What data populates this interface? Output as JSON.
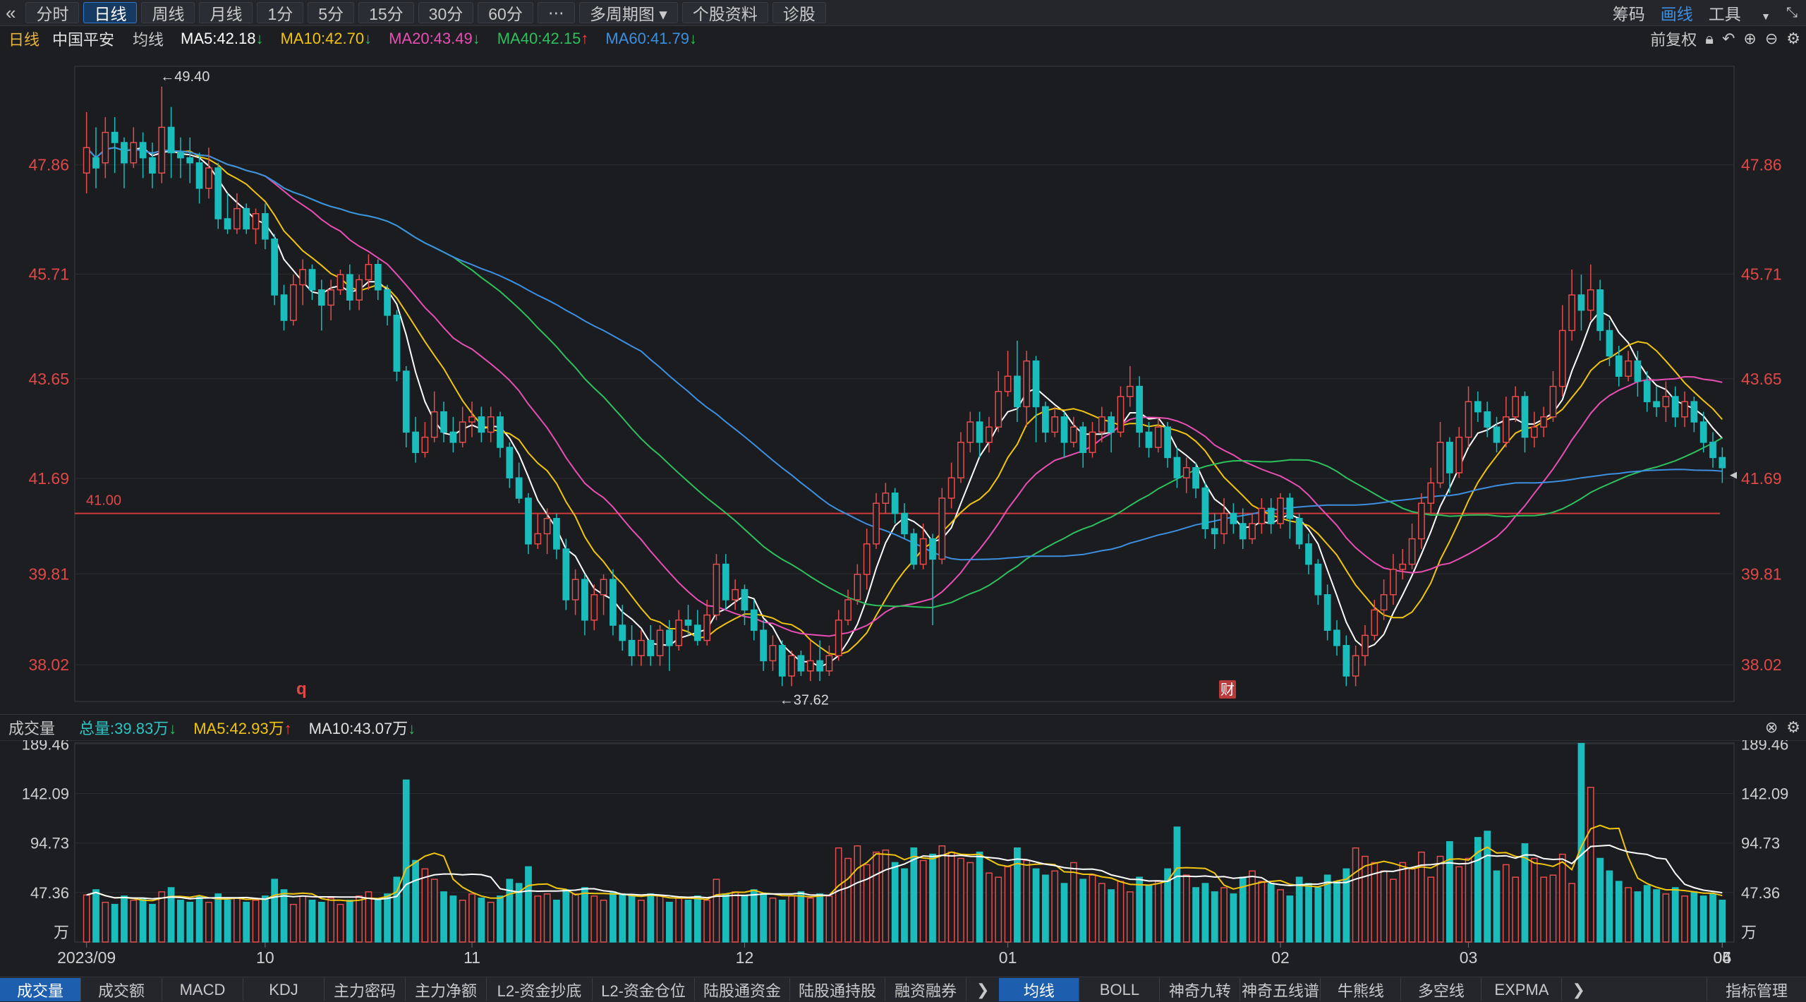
{
  "toolbar": {
    "back_icon": "back-chevron-icon",
    "tabs": [
      {
        "label": "分时",
        "active": false
      },
      {
        "label": "日线",
        "active": true
      },
      {
        "label": "周线",
        "active": false
      },
      {
        "label": "月线",
        "active": false
      },
      {
        "label": "1分",
        "active": false
      },
      {
        "label": "5分",
        "active": false
      },
      {
        "label": "15分",
        "active": false
      },
      {
        "label": "30分",
        "active": false
      },
      {
        "label": "60分",
        "active": false
      },
      {
        "label": "⋯",
        "active": false
      },
      {
        "label": "多周期图",
        "active": false
      },
      {
        "label": "个股资料",
        "active": false
      },
      {
        "label": "诊股",
        "active": false
      }
    ],
    "right": {
      "chips": "筹码",
      "draw": "画线",
      "tools": "工具"
    }
  },
  "info": {
    "period": "日线",
    "stock": "中国平安",
    "ma_label": "均线",
    "ma5": "MA5:42.18",
    "ma10": "MA10:42.70",
    "ma20": "MA20:43.49",
    "ma40": "MA40:42.15",
    "ma60": "MA60:41.79",
    "adjust": "前复权",
    "colors": {
      "ma5": "#ffffff",
      "ma10": "#f1c40f",
      "ma20": "#e84fb4",
      "ma40": "#2fbf5d",
      "ma60": "#3d8fe0"
    }
  },
  "volume_info": {
    "title": "成交量",
    "total": "总量:39.83万",
    "ma5": "MA5:42.93万",
    "ma10": "MA10:43.07万"
  },
  "price_axis": [
    "47.86",
    "45.71",
    "43.65",
    "41.69",
    "39.81",
    "38.02"
  ],
  "price_marks": {
    "high": "←49.40",
    "low": "←37.62",
    "line": "41.00"
  },
  "event_marks": {
    "q": "q",
    "fin": "财"
  },
  "volume_axis": [
    "189.46",
    "142.09",
    "94.73",
    "47.36",
    "万"
  ],
  "date_axis": [
    "2023/09",
    "10",
    "11",
    "12",
    "01",
    "02",
    "03",
    "04",
    "05",
    "06"
  ],
  "bottom_tabs_left": [
    "成交量",
    "成交额",
    "MACD",
    "KDJ",
    "主力密码",
    "主力净额",
    "L2-资金抄底",
    "L2-资金仓位",
    "陆股通资金",
    "陆股通持股",
    "融资融券"
  ],
  "bottom_tabs_right": [
    "均线",
    "BOLL",
    "神奇九转",
    "神奇五线谱",
    "牛熊线",
    "多空线",
    "EXPMA"
  ],
  "bottom_right": "指标管理",
  "chart_data": {
    "type": "candlestick",
    "series_prices": [
      [
        47.7,
        48.2,
        47.3,
        48.9
      ],
      [
        48.0,
        47.8,
        47.4,
        48.6
      ],
      [
        47.9,
        48.5,
        47.6,
        48.8
      ],
      [
        48.5,
        48.3,
        47.7,
        48.8
      ],
      [
        48.3,
        47.9,
        47.4,
        48.4
      ],
      [
        47.9,
        48.3,
        47.8,
        48.6
      ],
      [
        48.3,
        48.0,
        47.6,
        48.5
      ],
      [
        48.0,
        47.7,
        47.4,
        48.3
      ],
      [
        47.7,
        48.6,
        47.5,
        49.4
      ],
      [
        48.6,
        48.1,
        47.6,
        49.0
      ],
      [
        48.1,
        48.0,
        47.6,
        48.4
      ],
      [
        48.0,
        47.9,
        47.5,
        48.4
      ],
      [
        47.9,
        47.4,
        47.1,
        48.1
      ],
      [
        47.4,
        47.8,
        47.2,
        48.2
      ],
      [
        47.8,
        46.8,
        46.6,
        47.9
      ],
      [
        46.8,
        46.6,
        46.5,
        47.3
      ],
      [
        46.6,
        47.0,
        46.5,
        47.3
      ],
      [
        47.0,
        46.6,
        46.5,
        47.1
      ],
      [
        46.6,
        46.9,
        46.3,
        47.0
      ],
      [
        46.9,
        46.4,
        46.2,
        47.1
      ],
      [
        46.4,
        45.3,
        45.1,
        46.5
      ],
      [
        45.3,
        44.8,
        44.6,
        45.5
      ],
      [
        44.8,
        45.5,
        44.7,
        45.7
      ],
      [
        45.5,
        45.8,
        45.1,
        46.0
      ],
      [
        45.8,
        45.4,
        45.2,
        45.9
      ],
      [
        45.4,
        45.1,
        44.6,
        45.6
      ],
      [
        45.1,
        45.4,
        44.8,
        45.6
      ],
      [
        45.4,
        45.7,
        45.3,
        45.8
      ],
      [
        45.7,
        45.2,
        45.0,
        45.9
      ],
      [
        45.2,
        45.6,
        45.0,
        45.7
      ],
      [
        45.6,
        45.9,
        45.4,
        46.1
      ],
      [
        45.9,
        45.4,
        45.2,
        46.0
      ],
      [
        45.4,
        44.9,
        44.7,
        45.5
      ],
      [
        44.9,
        43.8,
        43.6,
        45.0
      ],
      [
        43.8,
        42.6,
        42.3,
        43.9
      ],
      [
        42.6,
        42.2,
        42.0,
        42.9
      ],
      [
        42.2,
        42.5,
        42.1,
        42.8
      ],
      [
        42.5,
        43.0,
        42.4,
        43.4
      ],
      [
        43.0,
        42.6,
        42.4,
        43.2
      ],
      [
        42.6,
        42.4,
        42.2,
        42.9
      ],
      [
        42.4,
        42.8,
        42.3,
        43.1
      ],
      [
        42.8,
        42.9,
        42.5,
        43.2
      ],
      [
        42.9,
        42.6,
        42.4,
        43.1
      ],
      [
        42.6,
        42.9,
        42.4,
        43.1
      ],
      [
        42.9,
        42.3,
        42.1,
        43.0
      ],
      [
        42.3,
        41.7,
        41.5,
        42.4
      ],
      [
        41.7,
        41.3,
        41.2,
        42.0
      ],
      [
        41.3,
        40.4,
        40.2,
        41.4
      ],
      [
        40.4,
        40.6,
        40.3,
        41.0
      ],
      [
        40.6,
        40.9,
        40.2,
        41.1
      ],
      [
        40.9,
        40.3,
        40.1,
        41.0
      ],
      [
        40.3,
        39.3,
        39.1,
        40.5
      ],
      [
        39.3,
        39.7,
        39.0,
        39.9
      ],
      [
        39.7,
        38.9,
        38.6,
        39.8
      ],
      [
        38.9,
        39.4,
        38.7,
        39.6
      ],
      [
        39.4,
        39.7,
        39.0,
        39.8
      ],
      [
        39.7,
        38.8,
        38.6,
        39.9
      ],
      [
        38.8,
        38.5,
        38.3,
        39.2
      ],
      [
        38.5,
        38.2,
        38.0,
        38.8
      ],
      [
        38.2,
        38.5,
        38.0,
        38.7
      ],
      [
        38.5,
        38.2,
        38.0,
        38.8
      ],
      [
        38.2,
        38.7,
        38.0,
        38.8
      ],
      [
        38.7,
        38.4,
        37.9,
        38.9
      ],
      [
        38.4,
        38.9,
        38.3,
        39.1
      ],
      [
        38.9,
        38.8,
        38.6,
        39.2
      ],
      [
        38.8,
        38.5,
        38.4,
        39.1
      ],
      [
        38.5,
        39.0,
        38.4,
        39.3
      ],
      [
        39.0,
        40.0,
        38.9,
        40.2
      ],
      [
        40.0,
        39.3,
        39.1,
        40.2
      ],
      [
        39.3,
        39.5,
        39.1,
        39.7
      ],
      [
        39.5,
        39.1,
        38.8,
        39.6
      ],
      [
        39.1,
        38.7,
        38.5,
        39.3
      ],
      [
        38.7,
        38.1,
        37.9,
        38.9
      ],
      [
        38.1,
        38.4,
        37.9,
        38.6
      ],
      [
        38.4,
        37.8,
        37.6,
        38.5
      ],
      [
        37.8,
        38.2,
        37.6,
        38.3
      ],
      [
        38.2,
        37.9,
        37.8,
        38.3
      ],
      [
        37.9,
        38.1,
        37.7,
        38.5
      ],
      [
        38.1,
        37.9,
        37.7,
        38.5
      ],
      [
        37.9,
        38.2,
        37.8,
        38.4
      ],
      [
        38.2,
        38.9,
        38.1,
        39.1
      ],
      [
        38.9,
        39.3,
        38.8,
        39.5
      ],
      [
        39.3,
        39.8,
        39.2,
        40.0
      ],
      [
        39.8,
        40.4,
        39.5,
        40.7
      ],
      [
        40.4,
        41.2,
        40.3,
        41.4
      ],
      [
        41.2,
        41.4,
        41.0,
        41.6
      ],
      [
        41.4,
        41.0,
        40.8,
        41.5
      ],
      [
        41.0,
        40.6,
        40.5,
        41.2
      ],
      [
        40.6,
        40.0,
        39.9,
        40.7
      ],
      [
        40.0,
        40.5,
        39.9,
        40.8
      ],
      [
        40.5,
        40.1,
        38.8,
        40.6
      ],
      [
        40.1,
        41.3,
        40.0,
        41.5
      ],
      [
        41.3,
        41.7,
        41.1,
        42.0
      ],
      [
        41.7,
        42.4,
        41.6,
        42.6
      ],
      [
        42.4,
        42.8,
        42.2,
        43.0
      ],
      [
        42.8,
        42.4,
        42.1,
        43.0
      ],
      [
        42.4,
        42.7,
        42.2,
        42.9
      ],
      [
        42.7,
        43.4,
        42.6,
        43.8
      ],
      [
        43.4,
        43.7,
        43.3,
        44.2
      ],
      [
        43.7,
        43.1,
        42.8,
        44.4
      ],
      [
        43.1,
        44.0,
        42.7,
        44.2
      ],
      [
        44.0,
        43.1,
        42.4,
        44.1
      ],
      [
        43.1,
        42.6,
        42.4,
        43.2
      ],
      [
        42.6,
        42.9,
        42.5,
        43.1
      ],
      [
        42.9,
        42.4,
        42.1,
        43.0
      ],
      [
        42.4,
        42.7,
        42.3,
        42.9
      ],
      [
        42.7,
        42.2,
        41.9,
        42.8
      ],
      [
        42.2,
        42.6,
        42.1,
        42.8
      ],
      [
        42.6,
        42.9,
        42.4,
        43.1
      ],
      [
        42.9,
        42.6,
        42.2,
        43.0
      ],
      [
        42.6,
        43.3,
        42.5,
        43.5
      ],
      [
        43.3,
        43.5,
        43.1,
        43.9
      ],
      [
        43.5,
        42.6,
        42.3,
        43.7
      ],
      [
        42.6,
        42.3,
        42.1,
        42.8
      ],
      [
        42.3,
        42.7,
        42.2,
        42.9
      ],
      [
        42.7,
        42.1,
        41.9,
        42.8
      ],
      [
        42.1,
        41.7,
        41.5,
        42.3
      ],
      [
        41.7,
        41.9,
        41.4,
        42.1
      ],
      [
        41.9,
        41.5,
        41.3,
        42.0
      ],
      [
        41.5,
        40.7,
        40.5,
        41.6
      ],
      [
        40.7,
        40.6,
        40.3,
        41.0
      ],
      [
        40.6,
        41.0,
        40.4,
        41.3
      ],
      [
        41.0,
        40.8,
        40.6,
        41.2
      ],
      [
        40.8,
        40.5,
        40.3,
        41.1
      ],
      [
        40.5,
        40.8,
        40.4,
        41.0
      ],
      [
        40.8,
        41.1,
        40.6,
        41.3
      ],
      [
        41.1,
        40.8,
        40.6,
        41.3
      ],
      [
        40.8,
        41.3,
        40.7,
        41.4
      ],
      [
        41.3,
        40.9,
        40.5,
        41.4
      ],
      [
        40.9,
        40.4,
        40.3,
        41.0
      ],
      [
        40.4,
        40.0,
        39.8,
        40.6
      ],
      [
        40.0,
        39.4,
        39.2,
        40.1
      ],
      [
        39.4,
        38.7,
        38.5,
        39.6
      ],
      [
        38.7,
        38.4,
        38.2,
        38.9
      ],
      [
        38.4,
        37.8,
        37.6,
        38.6
      ],
      [
        37.8,
        38.2,
        37.6,
        38.4
      ],
      [
        38.2,
        38.6,
        38.0,
        38.8
      ],
      [
        38.6,
        39.1,
        38.5,
        39.3
      ],
      [
        39.1,
        39.4,
        38.9,
        39.7
      ],
      [
        39.4,
        39.9,
        39.2,
        40.2
      ],
      [
        39.9,
        40.0,
        39.7,
        40.3
      ],
      [
        40.0,
        40.5,
        39.9,
        40.8
      ],
      [
        40.5,
        41.2,
        40.3,
        41.4
      ],
      [
        41.2,
        41.6,
        41.0,
        41.9
      ],
      [
        41.6,
        42.4,
        41.5,
        42.8
      ],
      [
        42.4,
        41.8,
        41.4,
        42.5
      ],
      [
        41.8,
        42.5,
        41.7,
        42.7
      ],
      [
        42.5,
        43.2,
        42.3,
        43.5
      ],
      [
        43.2,
        43.0,
        42.8,
        43.4
      ],
      [
        43.0,
        42.7,
        42.5,
        43.2
      ],
      [
        42.7,
        42.4,
        42.2,
        42.9
      ],
      [
        42.4,
        42.9,
        42.3,
        43.3
      ],
      [
        42.9,
        43.3,
        42.8,
        43.5
      ],
      [
        43.3,
        42.5,
        42.2,
        43.4
      ],
      [
        42.5,
        42.7,
        42.3,
        43.0
      ],
      [
        42.7,
        42.9,
        42.5,
        43.1
      ],
      [
        42.9,
        43.5,
        42.8,
        43.8
      ],
      [
        43.5,
        44.6,
        43.3,
        45.1
      ],
      [
        44.6,
        45.3,
        44.4,
        45.8
      ],
      [
        45.3,
        45.0,
        44.6,
        45.7
      ],
      [
        45.0,
        45.4,
        44.8,
        45.9
      ],
      [
        45.4,
        44.6,
        44.4,
        45.6
      ],
      [
        44.6,
        44.1,
        43.9,
        44.8
      ],
      [
        44.1,
        43.7,
        43.5,
        44.3
      ],
      [
        43.7,
        44.0,
        43.6,
        44.2
      ],
      [
        44.0,
        43.6,
        43.3,
        44.2
      ],
      [
        43.6,
        43.2,
        43.0,
        43.8
      ],
      [
        43.2,
        43.1,
        42.9,
        43.5
      ],
      [
        43.1,
        43.3,
        42.8,
        43.6
      ],
      [
        43.3,
        42.9,
        42.7,
        43.5
      ],
      [
        42.9,
        43.2,
        42.7,
        43.4
      ],
      [
        43.2,
        42.8,
        42.6,
        43.3
      ],
      [
        42.8,
        42.4,
        42.2,
        43.0
      ],
      [
        42.4,
        42.1,
        41.9,
        42.6
      ],
      [
        42.1,
        41.9,
        41.6,
        42.3
      ]
    ],
    "volumes_note": "approximate daily volume in 万 (10k), one per candle",
    "volumes": [
      45,
      50,
      38,
      36,
      44,
      40,
      42,
      36,
      48,
      52,
      40,
      38,
      44,
      38,
      46,
      40,
      42,
      38,
      40,
      44,
      60,
      50,
      36,
      44,
      40,
      38,
      42,
      36,
      40,
      44,
      48,
      40,
      46,
      62,
      155,
      78,
      70,
      60,
      48,
      44,
      40,
      46,
      42,
      38,
      44,
      60,
      56,
      72,
      44,
      46,
      40,
      50,
      46,
      52,
      44,
      40,
      48,
      46,
      44,
      40,
      46,
      44,
      38,
      42,
      40,
      44,
      40,
      60,
      46,
      48,
      44,
      50,
      46,
      42,
      40,
      44,
      48,
      42,
      46,
      44,
      90,
      80,
      92,
      74,
      86,
      88,
      76,
      70,
      90,
      78,
      84,
      92,
      86,
      80,
      76,
      86,
      66,
      62,
      72,
      90,
      78,
      70,
      64,
      68,
      56,
      76,
      60,
      64,
      56,
      50,
      58,
      48,
      62,
      54,
      58,
      70,
      110,
      64,
      52,
      56,
      48,
      52,
      46,
      62,
      68,
      58,
      56,
      50,
      44,
      62,
      56,
      52,
      64,
      58,
      70,
      90,
      82,
      76,
      68,
      60,
      76,
      70,
      86,
      62,
      82,
      96,
      72,
      80,
      100,
      106,
      68,
      74,
      62,
      94,
      80,
      62,
      64,
      84,
      56,
      190,
      148,
      80,
      68,
      58,
      52,
      48,
      54,
      50,
      46,
      52,
      44,
      48,
      44,
      46,
      40
    ],
    "ylim": [
      37.3,
      49.8
    ],
    "yticks": [
      47.86,
      45.71,
      43.65,
      41.69,
      39.81,
      38.02
    ]
  }
}
